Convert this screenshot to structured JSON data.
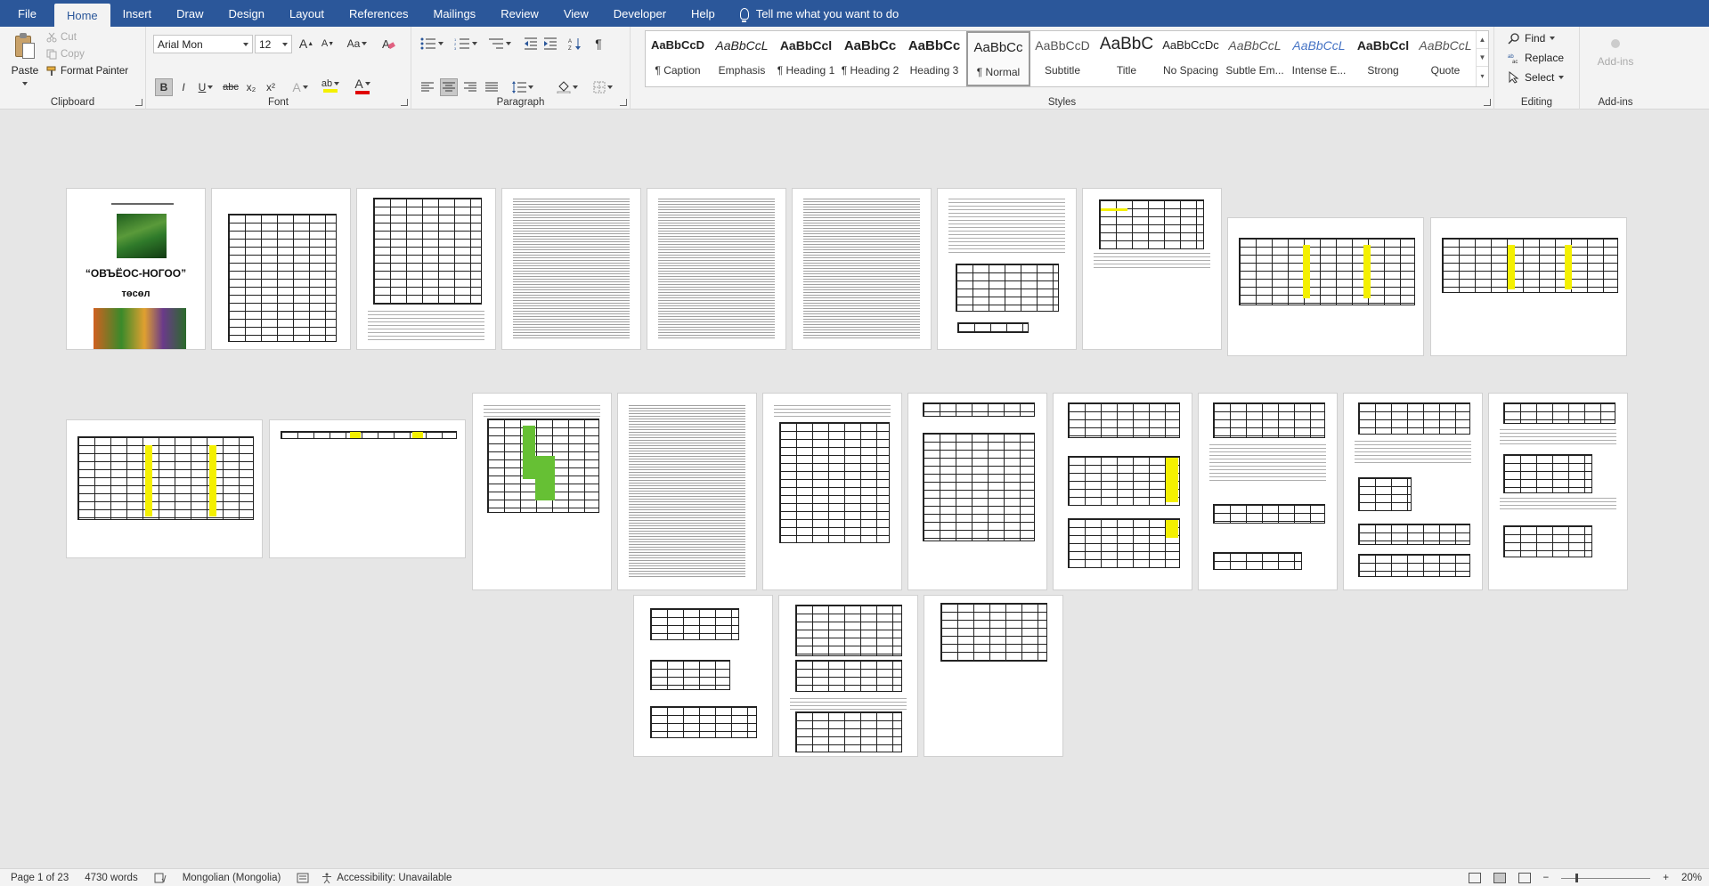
{
  "menu": {
    "file": "File",
    "tabs": [
      "Home",
      "Insert",
      "Draw",
      "Design",
      "Layout",
      "References",
      "Mailings",
      "Review",
      "View",
      "Developer",
      "Help"
    ],
    "tell_me": "Tell me what you want to do"
  },
  "ribbon": {
    "clipboard": {
      "paste": "Paste",
      "cut": "Cut",
      "copy": "Copy",
      "format_painter": "Format Painter",
      "label": "Clipboard"
    },
    "font": {
      "font_name": "Arial Mon",
      "font_size": "12",
      "label": "Font",
      "bold": "B",
      "italic": "I",
      "underline": "U",
      "strike": "abc",
      "subscript": "x₂",
      "superscript": "x²",
      "grow": "A",
      "shrink": "A",
      "case": "Aa",
      "font_color_letter": "A",
      "highlight_letter": "ab",
      "text_effects_letter": "A"
    },
    "paragraph": {
      "label": "Paragraph",
      "pilcrow": "¶"
    },
    "styles": {
      "label": "Styles",
      "items": [
        {
          "sample": "AaBbCcD",
          "name": "¶ Caption"
        },
        {
          "sample": "AaBbCcL",
          "name": "Emphasis"
        },
        {
          "sample": "AaBbCcl",
          "name": "¶ Heading 1"
        },
        {
          "sample": "AaBbCc",
          "name": "¶ Heading 2"
        },
        {
          "sample": "AaBbCc",
          "name": "Heading 3"
        },
        {
          "sample": "AaBbCc",
          "name": "¶ Normal"
        },
        {
          "sample": "AaBbCcD",
          "name": "Subtitle"
        },
        {
          "sample": "AaBbC",
          "name": "Title"
        },
        {
          "sample": "AaBbCcDc",
          "name": "No Spacing"
        },
        {
          "sample": "AaBbCcL",
          "name": "Subtle Em..."
        },
        {
          "sample": "AaBbCcL",
          "name": "Intense E..."
        },
        {
          "sample": "AaBbCcl",
          "name": "Strong"
        },
        {
          "sample": "AaBbCcL",
          "name": "Quote"
        }
      ],
      "selected_index": 5
    },
    "editing": {
      "label": "Editing",
      "find": "Find",
      "replace": "Replace",
      "select": "Select"
    },
    "addins": {
      "label": "Add-ins",
      "button": "Add-ins"
    }
  },
  "document": {
    "cover": {
      "title": "“ОВЪЁОС-НОГОО”",
      "subtitle": "төсөл"
    }
  },
  "status": {
    "page": "Page 1 of 23",
    "words": "4730 words",
    "language": "Mongolian (Mongolia)",
    "accessibility": "Accessibility: Unavailable",
    "zoom": "20%"
  },
  "colors": {
    "accent": "#2b579a",
    "highlight": "#f4f000",
    "chart_green": "#66c034"
  }
}
